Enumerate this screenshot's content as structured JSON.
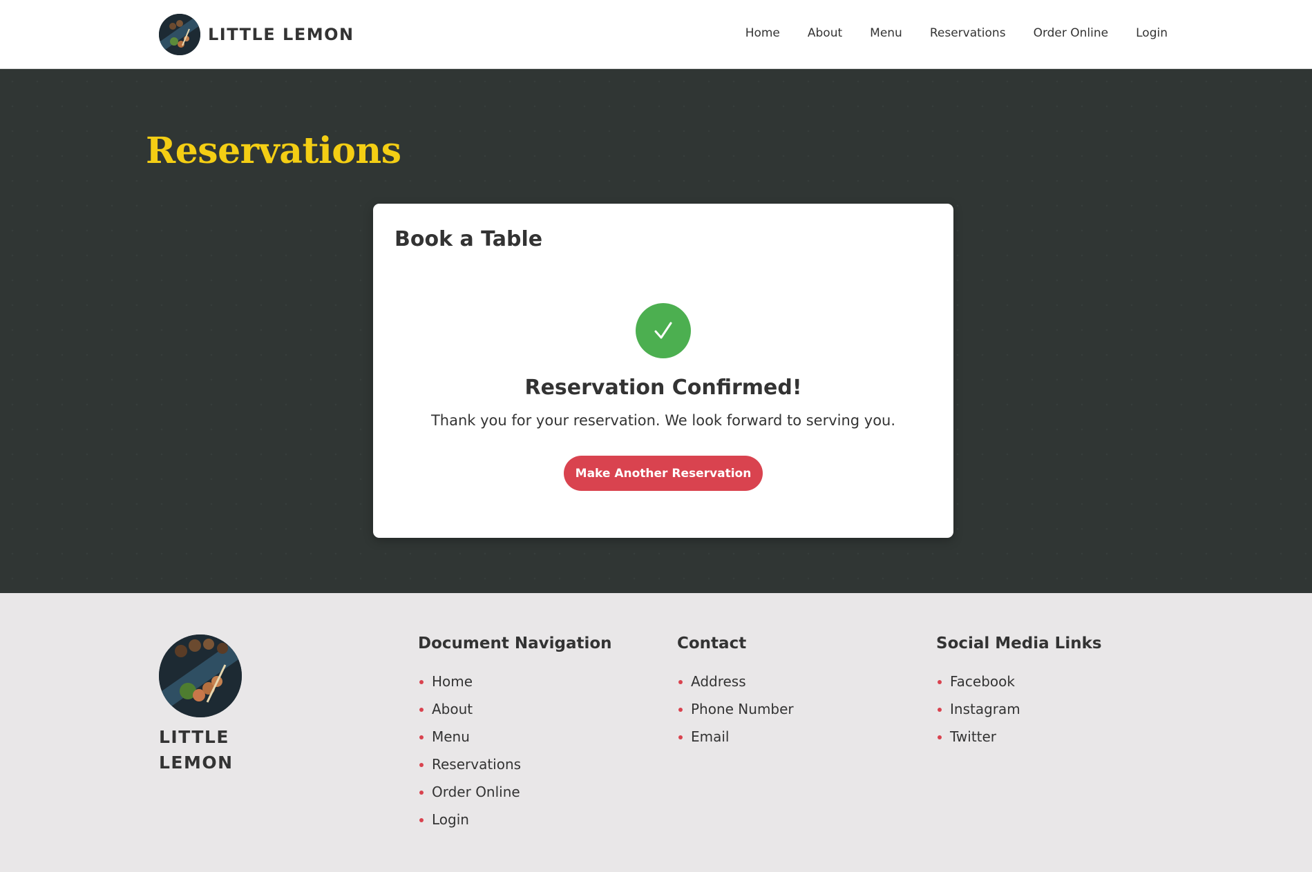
{
  "header": {
    "brand": "LITTLE LEMON",
    "nav": [
      "Home",
      "About",
      "Menu",
      "Reservations",
      "Order Online",
      "Login"
    ]
  },
  "hero": {
    "title": "Reservations"
  },
  "card": {
    "title": "Book a Table",
    "confirm_title": "Reservation Confirmed!",
    "confirm_message": "Thank you for your reservation. We look forward to serving you.",
    "button_label": "Make Another Reservation"
  },
  "footer": {
    "brand_line1": "LITTLE",
    "brand_line2": "LEMON",
    "doc_nav": {
      "heading": "Document Navigation",
      "items": [
        "Home",
        "About",
        "Menu",
        "Reservations",
        "Order Online",
        "Login"
      ]
    },
    "contact": {
      "heading": "Contact",
      "items": [
        "Address",
        "Phone Number",
        "Email"
      ]
    },
    "social": {
      "heading": "Social Media Links",
      "items": [
        "Facebook",
        "Instagram",
        "Twitter"
      ]
    }
  },
  "colors": {
    "accent_yellow": "#f4ce14",
    "hero_bg": "#303634",
    "button_red": "#d9434f",
    "success_green": "#4caf50",
    "footer_bg": "#e9e7e8"
  },
  "icons": {
    "logo": "food-plate-logo",
    "check": "check-icon"
  }
}
